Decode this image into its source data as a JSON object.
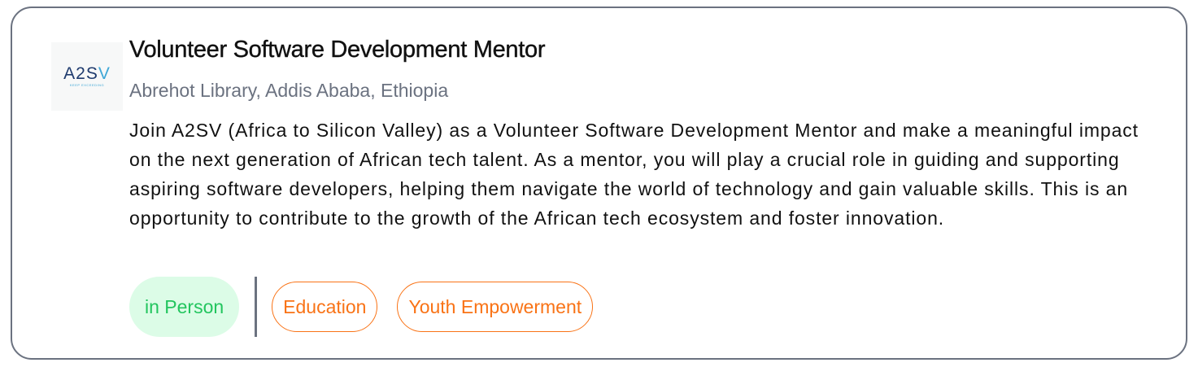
{
  "organization": {
    "logo_text_dark": "A2S",
    "logo_text_light": "V",
    "logo_tagline": "KEEP EXCEEDING"
  },
  "opportunity": {
    "title": "Volunteer Software Development Mentor",
    "location": "Abrehot Library, Addis Ababa, Ethiopia",
    "description": "Join A2SV (Africa to Silicon Valley) as a Volunteer Software Development Mentor and make a meaningful impact on the next generation of African tech talent. As a mentor, you will play a crucial role in guiding and supporting aspiring software developers, helping them navigate the world of technology and gain valuable skills. This is an opportunity to contribute to the growth of the African tech ecosystem and foster innovation."
  },
  "tags": {
    "mode": "in Person",
    "categories": [
      "Education",
      "Youth Empowerment"
    ]
  },
  "colors": {
    "mode_bg": "#dcfce7",
    "mode_text": "#22c55e",
    "category_accent": "#f97316",
    "card_border": "#6b7280",
    "muted_text": "#6b7280"
  }
}
